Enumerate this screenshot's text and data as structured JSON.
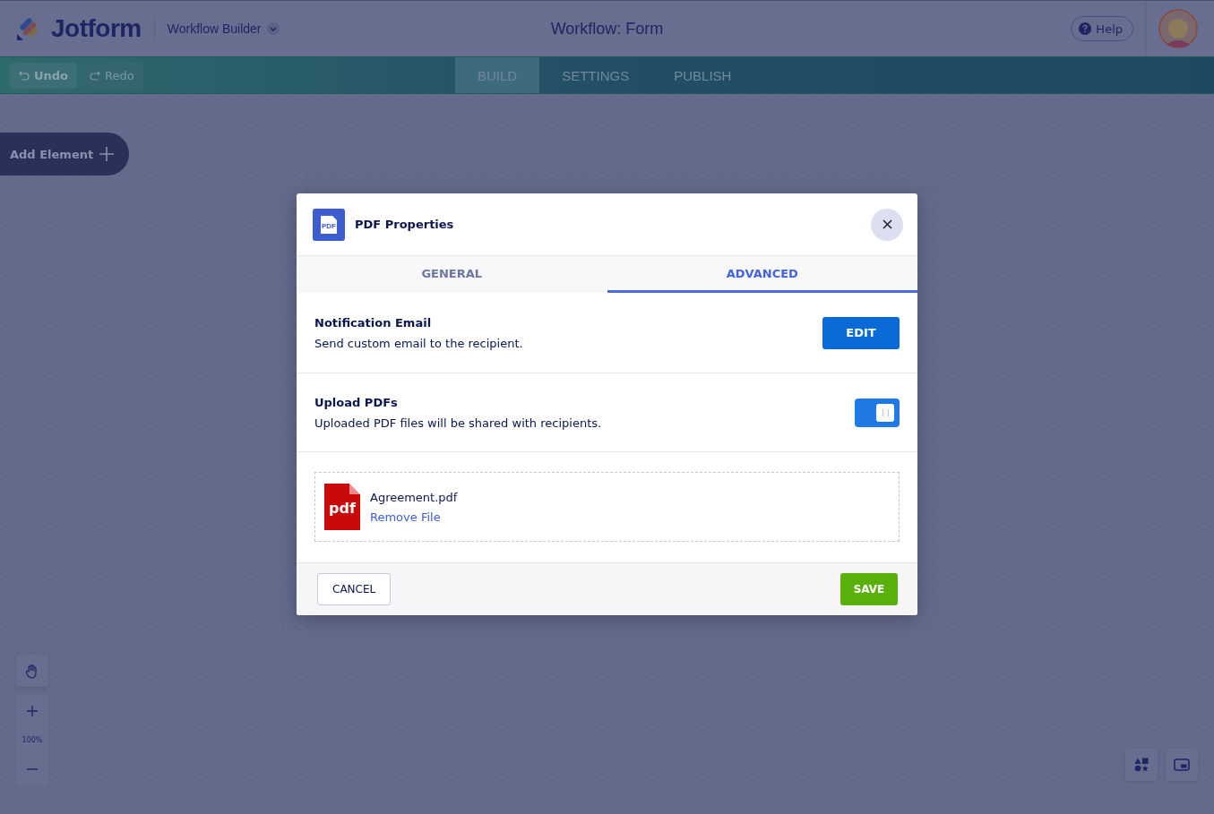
{
  "header": {
    "logo": "Jotform",
    "product": "Workflow Builder",
    "title": "Workflow: Form",
    "help": "Help"
  },
  "toolbar": {
    "actions": [
      {
        "kind": "undo",
        "label": "Undo",
        "disabled": false
      },
      {
        "kind": "redo",
        "label": "Redo",
        "disabled": true
      }
    ],
    "tabs": [
      {
        "label": "BUILD",
        "selected": true
      },
      {
        "label": "SETTINGS",
        "selected": false
      },
      {
        "label": "PUBLISH",
        "selected": false
      }
    ]
  },
  "add_element": "Add Element",
  "zoom": {
    "reading": "100%"
  },
  "dialog": {
    "icon_text": "PDF",
    "title": "PDF Properties",
    "tabs": [
      {
        "label": "GENERAL",
        "selected": false
      },
      {
        "label": "ADVANCED",
        "selected": true
      }
    ],
    "settings": [
      {
        "kind": "button",
        "title": "Notification Email",
        "description": "Send custom email to the recipient.",
        "button": "EDIT"
      },
      {
        "kind": "toggle",
        "title": "Upload PDFs",
        "description": "Uploaded PDF files will be shared with recipients.",
        "on": true
      }
    ],
    "file": {
      "icon_text": "pdf",
      "name": "Agreement.pdf",
      "remove": "Remove File"
    },
    "cancel": "CANCEL",
    "save": "SAVE"
  }
}
